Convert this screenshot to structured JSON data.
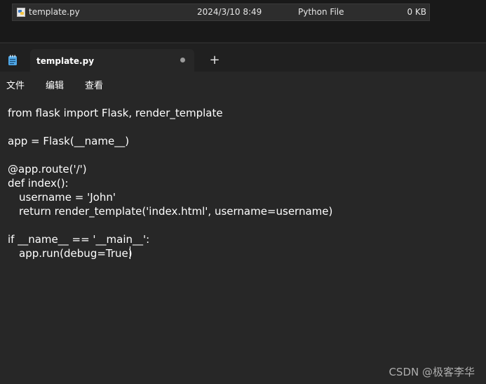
{
  "explorer": {
    "file": {
      "name": "template.py",
      "modified": "2024/3/10 8:49",
      "type": "Python File",
      "size": "0 KB"
    }
  },
  "notepad": {
    "tab_title": "template.py",
    "new_tab_symbol": "+",
    "menu": {
      "file": "文件",
      "edit": "编辑",
      "view": "查看"
    },
    "code": {
      "l1": "from flask import Flask, render_template",
      "l3": "app = Flask(__name__)",
      "l5": "@app.route('/')",
      "l6": "def index():",
      "l7": "username = 'John'",
      "l8": "return render_template('index.html', username=username)",
      "l10": "if __name__ == '__main__':",
      "l11": "app.run(debug=True)"
    }
  },
  "watermark": "CSDN @极客李华",
  "colors": {
    "python_icon_blue": "#3f7cc5",
    "python_icon_yellow": "#f5c542",
    "notepad_icon": "#4fa7e6"
  }
}
